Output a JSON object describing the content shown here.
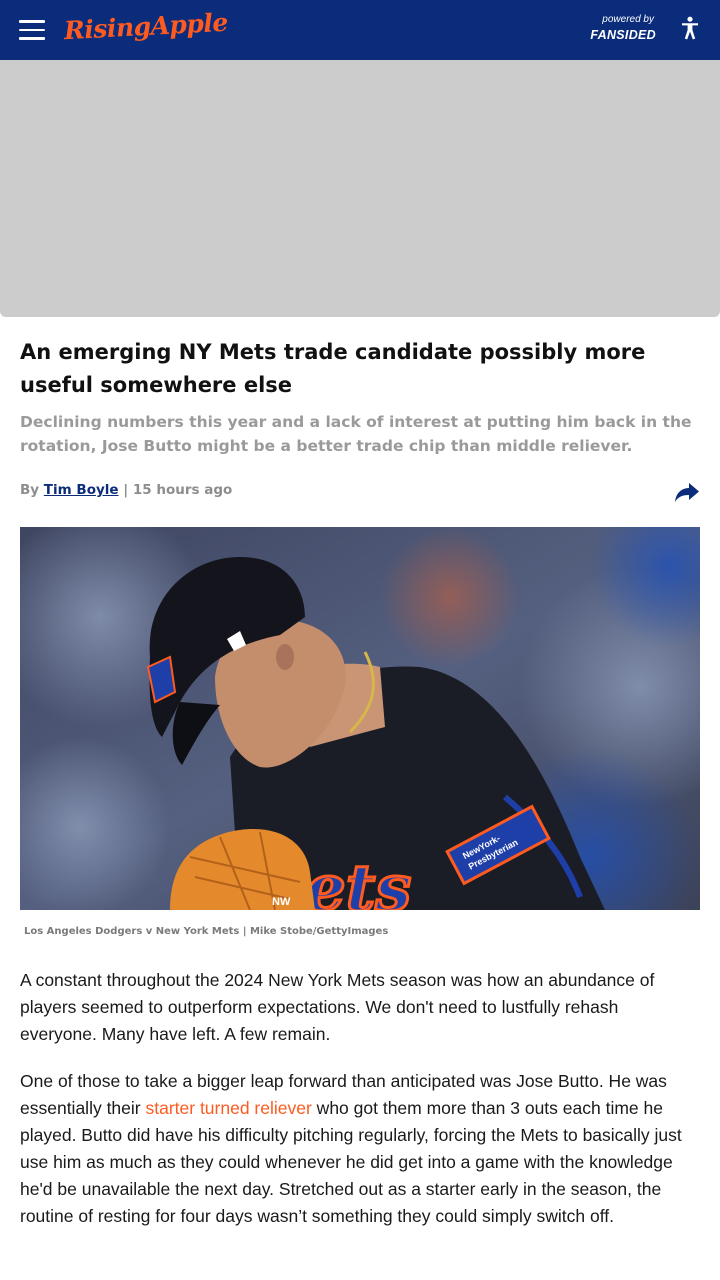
{
  "header": {
    "site_name": "RisingApple",
    "powered_by": "powered by",
    "network": "FANSIDED",
    "icons": [
      "menu-icon",
      "accessibility-icon"
    ],
    "colors": {
      "bar": "#0a2c7a",
      "logo": "#ff5a1f"
    }
  },
  "article": {
    "headline": "An emerging NY Mets trade candidate possibly more useful somewhere else",
    "dek": "Declining numbers this year and a lack of interest at putting him back in the rotation, Jose Butto might be a better trade chip than middle reliever.",
    "byline": {
      "prefix": "By",
      "author": "Tim Boyle",
      "separator": "|",
      "time": "15 hours ago"
    },
    "share_icon": "share-icon",
    "image": {
      "patch_text_1": "NewYork-",
      "patch_text_2": "Presbyterian",
      "jersey_text": "ets",
      "glove_text": "NW"
    },
    "caption": "Los Angeles Dodgers v New York Mets | Mike Stobe/GettyImages",
    "paragraphs": {
      "p1": "A constant throughout the 2024 New York Mets season was how an abundance of players seemed to outperform expectations. We don't need to lustfully rehash everyone. Many have left. A few remain.",
      "p2_before": "One of those to take a bigger leap forward than anticipated was Jose Butto. He was essentially their ",
      "p2_link": "starter turned reliever",
      "p2_after": " who got them more than 3 outs each time he played. Butto did have his difficulty pitching regularly, forcing the Mets to basically just use him as much as they could whenever he did get into a game with the knowledge he'd be unavailable the next day. Stretched out as a starter early in the season, the routine of resting for four days wasn’t something they could simply switch off."
    },
    "link_color": "#ff5a1f"
  }
}
